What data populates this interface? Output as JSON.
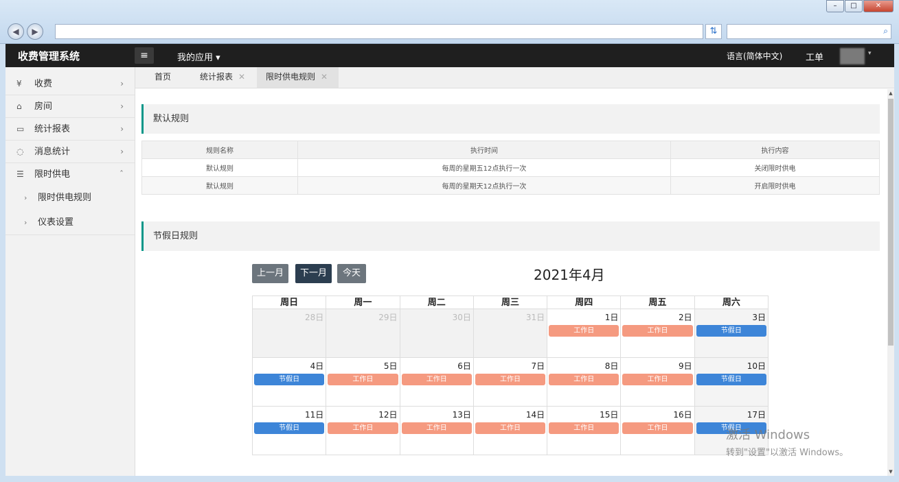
{
  "browser": {
    "minimize": "–",
    "maximize": "□",
    "close": "✕",
    "back_icon": "arrow-left-icon",
    "forward_icon": "arrow-right-icon"
  },
  "header": {
    "app_title": "收费管理系统",
    "my_apps": "我的应用",
    "language": "语言(简体中文)",
    "work_order": "工单"
  },
  "sidebar": {
    "items": [
      {
        "label": "收费",
        "icon": "yen-icon"
      },
      {
        "label": "房间",
        "icon": "home-icon"
      },
      {
        "label": "统计报表",
        "icon": "monitor-icon"
      },
      {
        "label": "消息统计",
        "icon": "chat-icon"
      },
      {
        "label": "限时供电",
        "icon": "sliders-icon"
      }
    ],
    "sub_items": [
      {
        "label": "限时供电规则"
      },
      {
        "label": "仪表设置"
      }
    ]
  },
  "tabs": [
    {
      "label": "首页"
    },
    {
      "label": "统计报表"
    },
    {
      "label": "限时供电规则"
    }
  ],
  "default_rules": {
    "title": "默认规则",
    "columns": [
      "规则名称",
      "执行时间",
      "执行内容"
    ],
    "rows": [
      [
        "默认规则",
        "每周的星期五12点执行一次",
        "关闭限时供电"
      ],
      [
        "默认规则",
        "每周的星期天12点执行一次",
        "开启限时供电"
      ]
    ]
  },
  "holiday_rules": {
    "title": "节假日规则"
  },
  "calendar": {
    "prev": "上一月",
    "next": "下一月",
    "today": "今天",
    "title": "2021年4月",
    "weekdays": [
      "周日",
      "周一",
      "周二",
      "周三",
      "周四",
      "周五",
      "周六"
    ],
    "weeks": [
      [
        {
          "day": "28日",
          "other": true
        },
        {
          "day": "29日",
          "other": true
        },
        {
          "day": "30日",
          "other": true
        },
        {
          "day": "31日",
          "other": true
        },
        {
          "day": "1日",
          "event": "工作日",
          "type": "work"
        },
        {
          "day": "2日",
          "event": "工作日",
          "type": "work"
        },
        {
          "day": "3日",
          "event": "节假日",
          "type": "holiday"
        }
      ],
      [
        {
          "day": "4日",
          "event": "节假日",
          "type": "holiday"
        },
        {
          "day": "5日",
          "event": "工作日",
          "type": "work"
        },
        {
          "day": "6日",
          "event": "工作日",
          "type": "work"
        },
        {
          "day": "7日",
          "event": "工作日",
          "type": "work"
        },
        {
          "day": "8日",
          "event": "工作日",
          "type": "work"
        },
        {
          "day": "9日",
          "event": "工作日",
          "type": "work"
        },
        {
          "day": "10日",
          "event": "节假日",
          "type": "holiday"
        }
      ],
      [
        {
          "day": "11日",
          "event": "节假日",
          "type": "holiday"
        },
        {
          "day": "12日",
          "event": "工作日",
          "type": "work"
        },
        {
          "day": "13日",
          "event": "工作日",
          "type": "work"
        },
        {
          "day": "14日",
          "event": "工作日",
          "type": "work"
        },
        {
          "day": "15日",
          "event": "工作日",
          "type": "work"
        },
        {
          "day": "16日",
          "event": "工作日",
          "type": "work"
        },
        {
          "day": "17日",
          "event": "节假日",
          "type": "holiday"
        }
      ]
    ]
  },
  "colors": {
    "work": "#f59a80",
    "holiday": "#3d85d8",
    "accent": "#009688",
    "header_bg": "#1f1f1f"
  },
  "watermark": {
    "line1": "激活 Windows",
    "line2": "转到\"设置\"以激活 Windows。"
  }
}
